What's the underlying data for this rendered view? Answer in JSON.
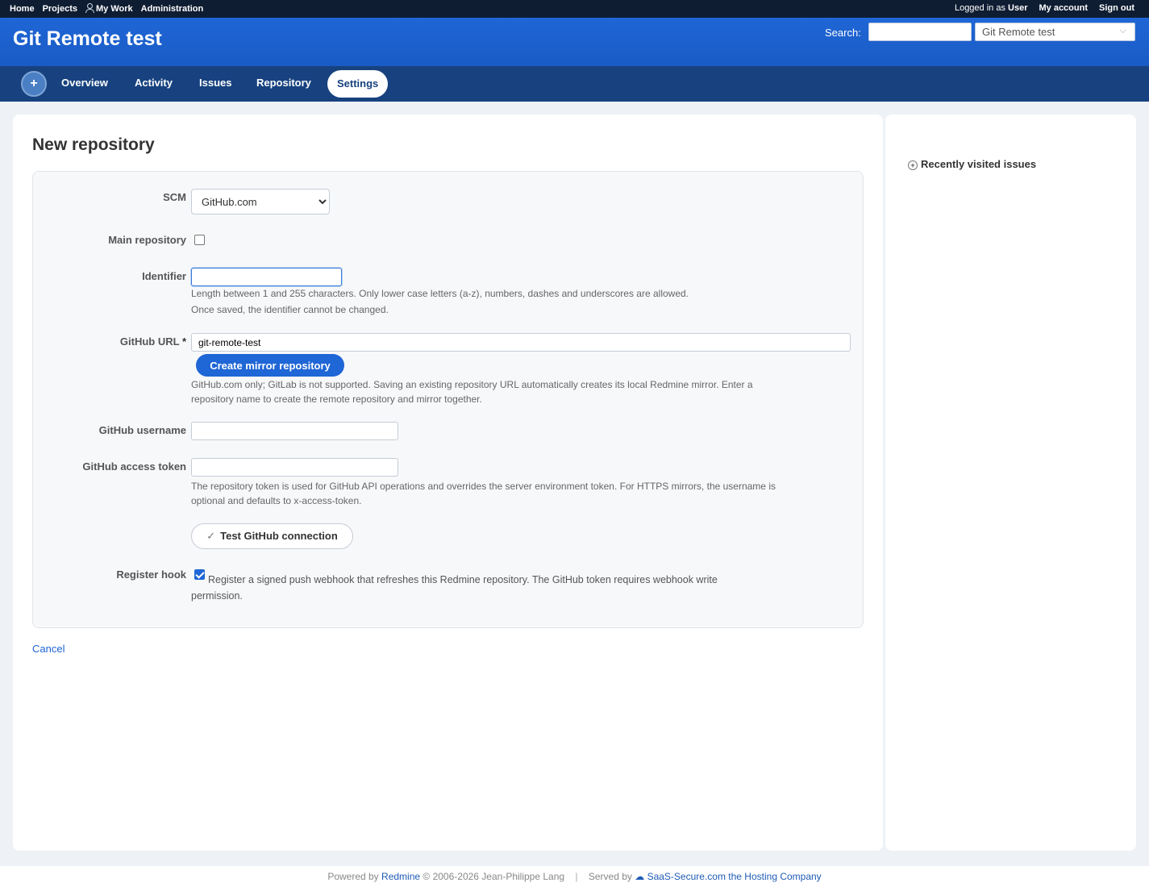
{
  "top_menu": {
    "home": "Home",
    "projects": "Projects",
    "my_work": "My Work",
    "administration": "Administration",
    "logged_in_prefix": "Logged in as",
    "user": "User",
    "my_account": "My account",
    "sign_out": "Sign out"
  },
  "header": {
    "project_title": "Git Remote test",
    "search_label": "Search:",
    "project_jump_value": "Git Remote test"
  },
  "main_menu": {
    "new_object": "+",
    "tabs": [
      "Overview",
      "Activity",
      "Issues",
      "Repository",
      "Settings"
    ],
    "selected_tab": "Settings"
  },
  "page": {
    "heading": "New repository",
    "cancel": "Cancel"
  },
  "form": {
    "scm_label": "SCM",
    "scm_value": "GitHub.com",
    "main_repository_label": "Main repository",
    "main_repository_checked": false,
    "identifier_label": "Identifier",
    "identifier_value": "",
    "identifier_hint_1": "Length between 1 and 255 characters. Only lower case letters (a-z), numbers, dashes and underscores are allowed.",
    "identifier_hint_2": "Once saved, the identifier cannot be changed.",
    "github_url_label": "GitHub URL",
    "required_marker": "*",
    "github_url_value": "git-remote-test",
    "create_mirror_button": "Create mirror repository",
    "github_url_hint_1": "GitHub.com only; GitLab is not supported. Saving an existing repository URL automatically creates its local Redmine mirror. Enter a",
    "github_url_hint_2": "repository name to create the remote repository and mirror together.",
    "github_username_label": "GitHub username",
    "github_username_value": "",
    "github_token_label": "GitHub access token",
    "github_token_value": "",
    "token_hint_1": "The repository token is used for GitHub API operations and overrides the server environment token. For HTTPS mirrors, the username is",
    "token_hint_2": "optional and defaults to x-access-token.",
    "test_connection_button": "Test GitHub connection",
    "register_hook_label": "Register hook",
    "register_hook_checked": true,
    "register_hook_text_1": "Register a signed push webhook that refreshes this Redmine repository. The GitHub token requires webhook write",
    "register_hook_text_2": "permission."
  },
  "sidebar": {
    "toggle": "»",
    "recently_visited": "Recently visited issues"
  },
  "footer": {
    "powered_by": "Powered by",
    "redmine": "Redmine",
    "copyright": "© 2006-2026 Jean-Philippe Lang",
    "separator": "|",
    "served_by": "Served by",
    "host": "SaaS-Secure.com the Hosting Company"
  },
  "colors": {
    "accent": "#1f66d6",
    "top_bar": "#0f1d33",
    "nav_bar": "#17427f"
  },
  "icons": {
    "my_work": "person-icon",
    "new_object": "plus-icon",
    "project_jump": "chevron-down-icon",
    "sidebar_toggle": "double-chevron-right-icon",
    "recent_issues": "expander-icon",
    "test_connection": "check-icon",
    "footer_host": "cloud-icon"
  }
}
